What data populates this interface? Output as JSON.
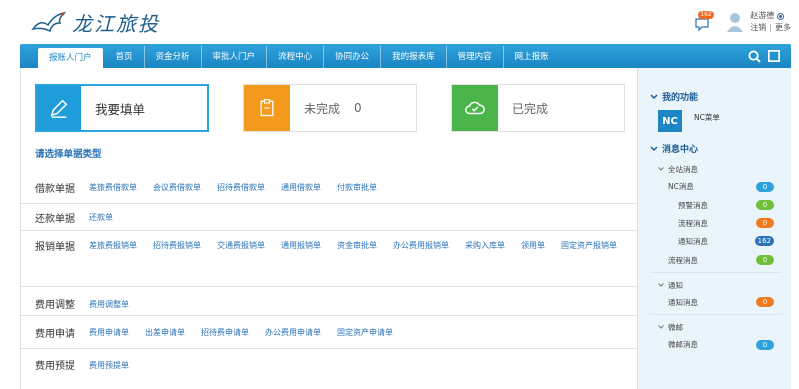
{
  "header": {
    "logo_text": "龙江旅投",
    "message_count": "162",
    "username": "赵游德",
    "logout": "注销",
    "more": "更多"
  },
  "nav": {
    "items": [
      "报账人门户",
      "首页",
      "资金分析",
      "审批人门户",
      "流程中心",
      "协同办公",
      "我的报表库",
      "管理内容",
      "网上报账"
    ]
  },
  "cards": {
    "fill": {
      "label": "我要填单"
    },
    "unfinished": {
      "label": "未完成",
      "count": "0"
    },
    "done": {
      "label": "已完成"
    }
  },
  "section_title": "请选择单据类型",
  "categories": [
    {
      "label": "借款单据",
      "links": [
        "差旅费借款单",
        "会议费借款单",
        "招待费借款单",
        "通用借款单",
        "付款审批单"
      ]
    },
    {
      "label": "还款单据",
      "links": [
        "还款单"
      ]
    },
    {
      "label": "报销单据",
      "links": [
        "差旅费报销单",
        "招待费报销单",
        "交通费报销单",
        "通用报销单",
        "资金审批单",
        "办公费用报销单",
        "采购入库单",
        "领用单",
        "固定资产报销单"
      ]
    },
    {
      "label": "费用调整",
      "links": [
        "费用调整单"
      ]
    },
    {
      "label": "费用申请",
      "links": [
        "费用申请单",
        "出差申请单",
        "招待费申请单",
        "办公费用申请单",
        "固定资产申请单"
      ]
    },
    {
      "label": "费用预提",
      "links": [
        "费用预提单"
      ]
    }
  ],
  "sidebar": {
    "my_functions": "我的功能",
    "nc_icon": "NC",
    "nc_label": "NC菜单",
    "message_center": "消息中心",
    "tree": {
      "all": "全站消息",
      "nc_messages": {
        "label": "NC消息",
        "count": "0"
      },
      "alert": {
        "label": "预警消息",
        "count": "0"
      },
      "flow": {
        "label": "流程消息",
        "count": "0"
      },
      "notice": {
        "label": "通知消息",
        "count": "162"
      },
      "process": {
        "label": "流程消息",
        "count": "0"
      },
      "notify_group": "通知",
      "notify_msg": {
        "label": "通知消息",
        "count": "0"
      },
      "weibo_group": "微邮",
      "weibo_msg": {
        "label": "微邮消息",
        "count": "0"
      }
    }
  }
}
